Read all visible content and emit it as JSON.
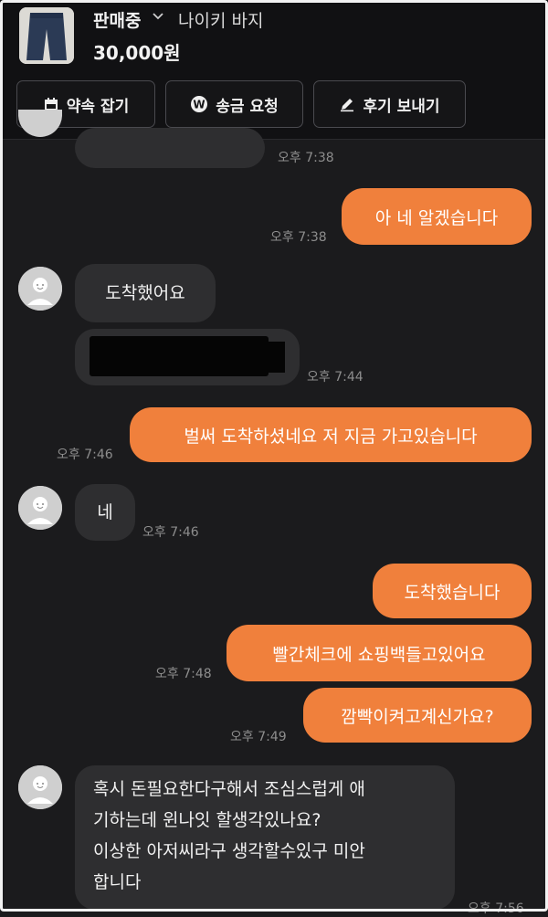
{
  "header": {
    "status": "판매중",
    "chevron_icon": "chevron-down-icon",
    "product_title": "나이키 바지",
    "price": "30,000원",
    "actions": [
      {
        "label": "약속 잡기",
        "icon": "calendar-icon"
      },
      {
        "label": "송금 요청",
        "icon": "won-coin-icon"
      },
      {
        "label": "후기 보내기",
        "icon": "pencil-icon"
      }
    ]
  },
  "messages": [
    {
      "side": "in",
      "text": "",
      "time": "오후 7:38"
    },
    {
      "side": "out",
      "text": "아 네 알겠습니다",
      "time": "오후 7:38"
    },
    {
      "side": "in",
      "text": "도착했어요",
      "time": ""
    },
    {
      "side": "in",
      "text": "",
      "time": "오후 7:44",
      "redacted": true
    },
    {
      "side": "out",
      "text": "벌써 도착하셨네요 저 지금 가고있습니다",
      "time": "오후 7:46"
    },
    {
      "side": "in",
      "text": "네",
      "time": "오후 7:46"
    },
    {
      "side": "out",
      "text": "도착했습니다",
      "time": ""
    },
    {
      "side": "out",
      "text": "빨간체크에 쇼핑백들고있어요",
      "time": "오후 7:48"
    },
    {
      "side": "out",
      "text": "깜빡이켜고계신가요?",
      "time": "오후 7:49"
    },
    {
      "side": "in",
      "lines": [
        "혹시 돈필요한다구해서 조심스럽게 애",
        "기하는데 윈나잇 할생각있나요?",
        "이상한 아저씨라구 생각할수있구 미안",
        "합니다"
      ],
      "time": "오후 7:56"
    }
  ],
  "colors": {
    "background": "#1b1b1d",
    "header_bg": "#111113",
    "outgoing_bubble": "#f0803c",
    "incoming_bubble": "#2e2e30"
  }
}
